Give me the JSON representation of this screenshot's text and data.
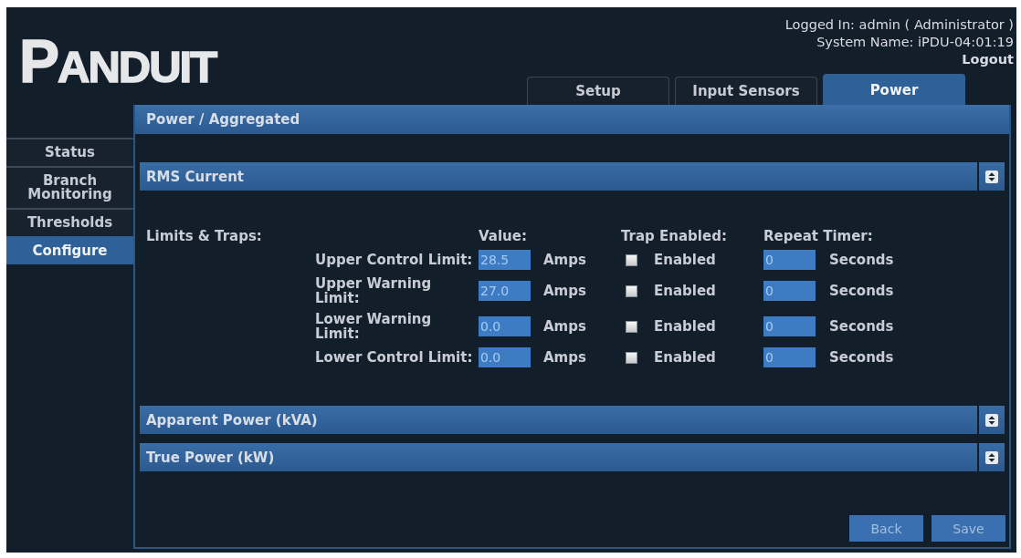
{
  "header": {
    "logo": "PANDUIT",
    "logged_in": "Logged In: admin ( Administrator )",
    "system_name": "System Name: iPDU-04:01:19",
    "logout": "Logout"
  },
  "tabs": [
    {
      "label": "Setup",
      "selected": false
    },
    {
      "label": "Input Sensors",
      "selected": false
    },
    {
      "label": "Power",
      "selected": true
    }
  ],
  "sidebar": {
    "items": [
      {
        "label": "Status",
        "selected": false
      },
      {
        "label": "Branch Monitoring",
        "selected": false
      },
      {
        "label": "Thresholds",
        "selected": false
      },
      {
        "label": "Configure",
        "selected": true
      }
    ]
  },
  "panel": {
    "title": "Power / Aggregated",
    "sections": [
      {
        "title": "RMS Current",
        "limits": {
          "label": "Limits & Traps:",
          "columns": [
            "Value:",
            "Trap Enabled:",
            "Repeat Timer:"
          ],
          "rows": [
            {
              "label": "Upper Control Limit:",
              "value": "28.5",
              "unit": "Amps",
              "trap": {
                "label": "Enabled",
                "checked": false
              },
              "timer": "0",
              "timer_unit": "Seconds"
            },
            {
              "label": "Upper Warning Limit:",
              "value": "27.0",
              "unit": "Amps",
              "trap": {
                "label": "Enabled",
                "checked": false
              },
              "timer": "0",
              "timer_unit": "Seconds"
            },
            {
              "label": "Lower Warning Limit:",
              "value": "0.0",
              "unit": "Amps",
              "trap": {
                "label": "Enabled",
                "checked": false
              },
              "timer": "0",
              "timer_unit": "Seconds"
            },
            {
              "label": "Lower Control Limit:",
              "value": "0.0",
              "unit": "Amps",
              "trap": {
                "label": "Enabled",
                "checked": false
              },
              "timer": "0",
              "timer_unit": "Seconds"
            }
          ]
        }
      },
      {
        "title": "Apparent Power (kVA)"
      },
      {
        "title": "True Power (kW)"
      }
    ],
    "buttons": [
      {
        "label": "Back"
      },
      {
        "label": "Save"
      }
    ]
  }
}
